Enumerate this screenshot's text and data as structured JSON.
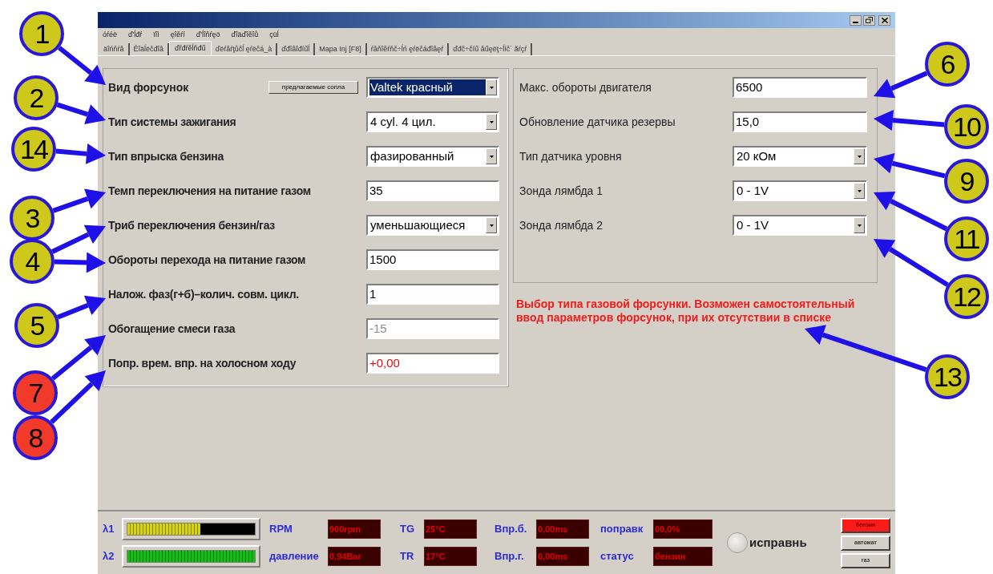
{
  "window": {
    "menu": [
      "óŕéë",
      "ď'ĺđŕ",
      "ïîì",
      "ęîěŕí",
      "ď'ĺîňŕęö",
      "ďîäďîěîů",
      "çüĺ"
    ],
    "tabs": [
      {
        "label": "äîńňŕâ",
        "selected": false
      },
      {
        "label": "Ěîäĺëčđîâ",
        "selected": false
      },
      {
        "label": "ďŕđŕěĺňđű",
        "selected": true
      },
      {
        "label": "ďëŕâŕţůčĺ ęŕëčá_à",
        "selected": false
      },
      {
        "label": "ďđîâîđíűĺ",
        "selected": false
      },
      {
        "label": "Mapa Inj [F8]",
        "selected": false
      },
      {
        "label": "ŕâňîěŕňč÷ĺń ęŕëčáđîâęŕ",
        "selected": false
      },
      {
        "label": "ďđč÷číű âűęëţ÷ĺíč˙ ăŕçŕ",
        "selected": false
      }
    ]
  },
  "left_settings": [
    {
      "label": "Вид форсунок",
      "kind": "combo",
      "value": "Valtek красный",
      "selected": true,
      "button": "предлагаемые сопла"
    },
    {
      "label": "Тип системы зажигания",
      "kind": "combo",
      "value": "4 cyl. 4 цил.",
      "selected": false
    },
    {
      "label": "Тип впрыска бензина",
      "kind": "combo",
      "value": "фазированный",
      "selected": false
    },
    {
      "label": "Темп переключения на питание газом",
      "kind": "text",
      "value": "35"
    },
    {
      "label": "Триб переключения бензин/газ",
      "kind": "combo",
      "value": "уменьшающиеся",
      "selected": false
    },
    {
      "label": "Обороты  перехода на питание газом",
      "kind": "text",
      "value": "1500"
    },
    {
      "label": "Налож. фаз(г+б)–колич. совм. цикл.",
      "kind": "text",
      "value": "1"
    },
    {
      "label": "Обогащение смеси газа",
      "kind": "text",
      "value": "-15",
      "disabled": true
    },
    {
      "label": "Попр. врем. впр. на холосном ходу",
      "kind": "text",
      "value": "+0,00",
      "alert": true
    }
  ],
  "right_settings": [
    {
      "label": "Макс. обороты двигателя",
      "kind": "text",
      "value": "6500"
    },
    {
      "label": "Обновление датчика резервы",
      "kind": "text",
      "value": "15,0"
    },
    {
      "label": "Тип датчика уровня",
      "kind": "combo",
      "value": "20 кОм",
      "selected": false
    },
    {
      "label": "Зонда лямбда 1",
      "kind": "combo",
      "value": "0 - 1V",
      "selected": false
    },
    {
      "label": "Зонда лямбда 2",
      "kind": "combo",
      "value": "0 - 1V",
      "selected": false
    }
  ],
  "hint": "Выбор типа газовой форсунки. Возможен самостоятельный ввод параметров  форсунок, при их отсутствии в списке",
  "status_panel": {
    "lambdas": [
      {
        "label": "λ1",
        "level": 0.57,
        "color": "#d8d400"
      },
      {
        "label": "λ2",
        "level": 1,
        "color": "#10c010"
      }
    ],
    "readout_columns": [
      [
        {
          "label": "RPM",
          "value": "900rpm"
        },
        {
          "label": "давление",
          "value": "0,94Bar"
        }
      ],
      [
        {
          "label": "TG",
          "value": "25°C"
        },
        {
          "label": "TR",
          "value": "17°C"
        }
      ],
      [
        {
          "label": "Впр.б.",
          "value": "0,00ms"
        },
        {
          "label": "Впр.г.",
          "value": "0,00ms"
        }
      ],
      [
        {
          "label": "поправк",
          "value": "00,0%"
        },
        {
          "label": "статус",
          "value": "бензин"
        }
      ]
    ],
    "indicator": {
      "label": "исправнь",
      "on": false
    },
    "mode_buttons": [
      {
        "label": "бензин",
        "selected": true
      },
      {
        "label": "автомат",
        "selected": false
      },
      {
        "label": "газ",
        "selected": false
      }
    ]
  },
  "callouts": [
    {
      "number": "1",
      "color": "#cdc81a"
    },
    {
      "number": "2",
      "color": "#cdc81a"
    },
    {
      "number": "14",
      "color": "#cdc81a"
    },
    {
      "number": "3",
      "color": "#cdc81a"
    },
    {
      "number": "4",
      "color": "#cdc81a"
    },
    {
      "number": "5",
      "color": "#cdc81a"
    },
    {
      "number": "7",
      "color": "#f23a2a"
    },
    {
      "number": "8",
      "color": "#f23a2a"
    },
    {
      "number": "6",
      "color": "#cdc81a"
    },
    {
      "number": "10",
      "color": "#cdc81a"
    },
    {
      "number": "9",
      "color": "#cdc81a"
    },
    {
      "number": "11",
      "color": "#cdc81a"
    },
    {
      "number": "12",
      "color": "#cdc81a"
    },
    {
      "number": "13",
      "color": "#cdc81a"
    }
  ]
}
